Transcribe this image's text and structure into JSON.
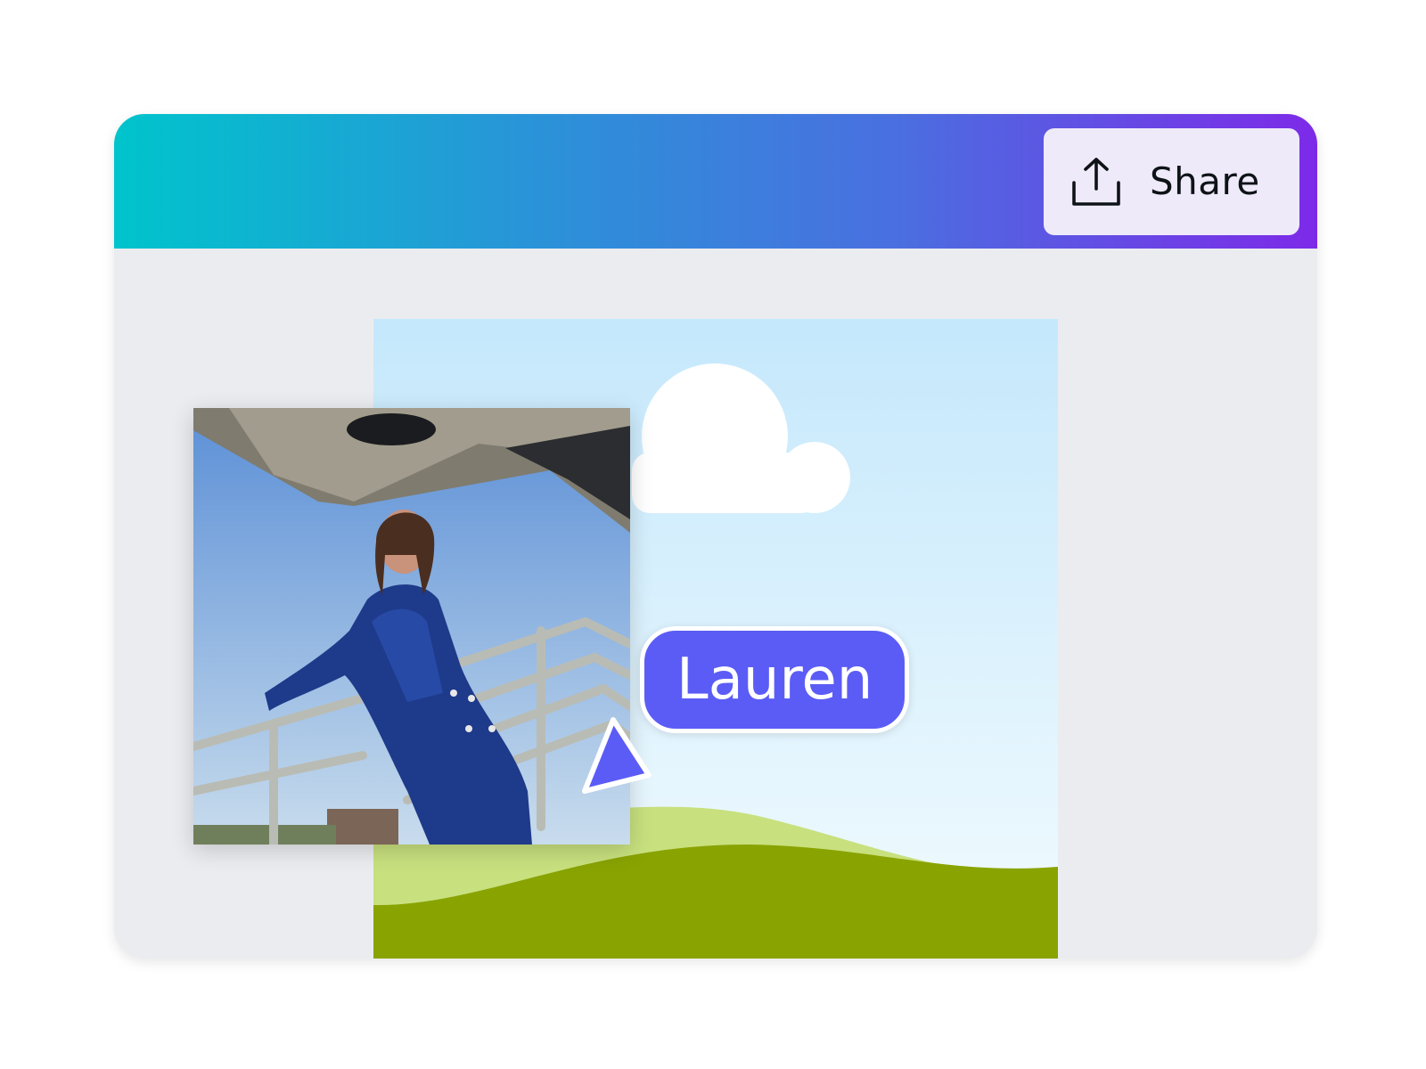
{
  "toolbar": {
    "share_label": "Share",
    "share_icon": "upload-share-icon",
    "gradient_colors": [
      "#00c4cc",
      "#7d2ae8"
    ]
  },
  "canvas": {
    "background": "sky-and-hills-illustration",
    "sky_color": "#c9e9fb",
    "hill_light_color": "#c8e07e",
    "hill_dark_color": "#89a300"
  },
  "photo": {
    "description_icon": "photo-woman-blue-suit"
  },
  "collaborator": {
    "name": "Lauren",
    "color": "#5b5cf6"
  }
}
